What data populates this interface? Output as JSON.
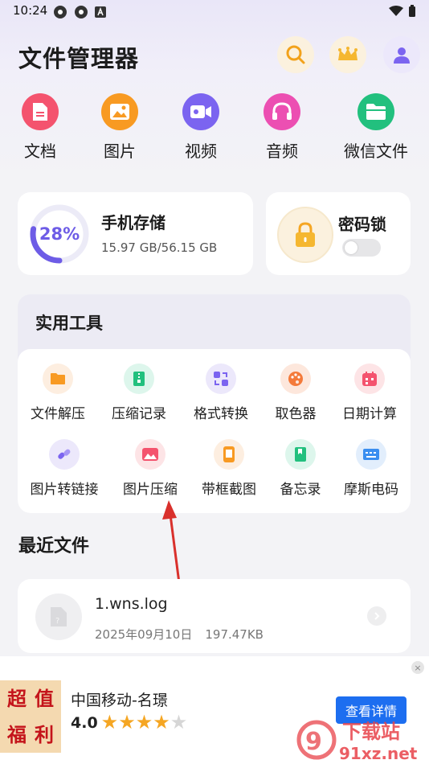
{
  "status_bar": {
    "time": "10:24"
  },
  "app": {
    "title": "文件管理器"
  },
  "categories": [
    {
      "label": "文档",
      "color": "#f4536e"
    },
    {
      "label": "图片",
      "color": "#f89a22"
    },
    {
      "label": "视频",
      "color": "#7b64f0"
    },
    {
      "label": "音频",
      "color": "#ec4fb2"
    },
    {
      "label": "微信文件",
      "color": "#22c07e"
    }
  ],
  "storage": {
    "title": "手机存储",
    "percent": "28%",
    "percent_value": 0.28,
    "usage": "15.97 GB/56.15 GB"
  },
  "lock": {
    "title": "密码锁",
    "enabled": false
  },
  "tools": {
    "title": "实用工具",
    "items": [
      {
        "label": "文件解压"
      },
      {
        "label": "压缩记录"
      },
      {
        "label": "格式转换"
      },
      {
        "label": "取色器"
      },
      {
        "label": "日期计算"
      },
      {
        "label": "图片转链接"
      },
      {
        "label": "图片压缩"
      },
      {
        "label": "带框截图"
      },
      {
        "label": "备忘录"
      },
      {
        "label": "摩斯电码"
      }
    ]
  },
  "recent": {
    "title": "最近文件",
    "files": [
      {
        "name": "1.wns.log",
        "date": "2025年09月10日",
        "size": "197.47KB"
      }
    ]
  },
  "ad": {
    "image_text": [
      "超",
      "值",
      "福",
      "利"
    ],
    "title": "中国移动-名璟",
    "rating": "4.0",
    "stars": 4,
    "button": "查看详情",
    "close": "×"
  },
  "watermark": {
    "text": "下载站",
    "url_text": "91xz.net"
  }
}
